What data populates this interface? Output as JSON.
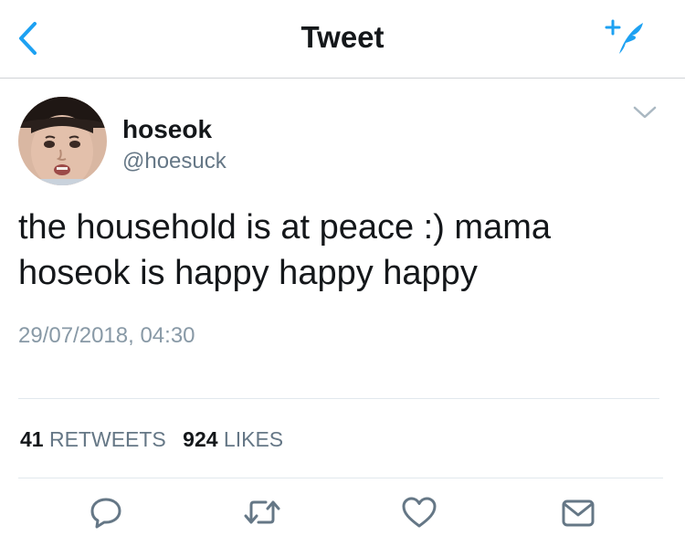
{
  "header": {
    "title": "Tweet",
    "back_icon": "chevron-left-icon",
    "compose_icon": "compose-feather-icon"
  },
  "tweet": {
    "author": {
      "name": "hoseok",
      "handle": "@hoesuck"
    },
    "text": "the household is at peace :) mama\nhoseok is happy happy happy",
    "timestamp": "29/07/2018, 04:30",
    "stats": {
      "retweets_count": "41",
      "retweets_label": "RETWEETS",
      "likes_count": "924",
      "likes_label": "LIKES"
    }
  },
  "actions": [
    "reply-icon",
    "retweet-icon",
    "like-icon",
    "share-icon"
  ],
  "colors": {
    "accent": "#1da1f2",
    "text_primary": "#14171a",
    "text_secondary": "#657786",
    "divider": "#e1e8ed"
  }
}
